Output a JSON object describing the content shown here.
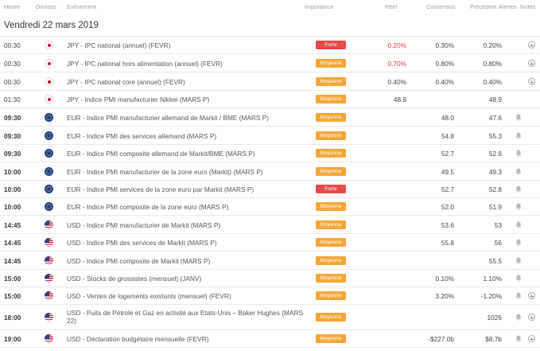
{
  "columns": {
    "time": "Heure",
    "currency": "Devises",
    "event": "Evènement",
    "importance": "Importance",
    "actual": "Réel",
    "consensus": "Consensus",
    "previous": "Précédent",
    "alerts": "Alertes",
    "notes": "Notes"
  },
  "date_heading": "Vendredi 22 mars 2019",
  "rows": [
    {
      "time": "00:30",
      "bold": false,
      "flag": "flag-japan",
      "event": "JPY - IPC national (annuel) (FEVR)",
      "importance": "Forte",
      "level": "high",
      "actual": "0.20%",
      "actual_red": true,
      "consensus": "0.30%",
      "previous": "0.20%",
      "bell": false,
      "plus": true
    },
    {
      "time": "00:30",
      "bold": false,
      "flag": "flag-japan",
      "event": "JPY - IPC national hors alimentation (annuel) (FEVR)",
      "importance": "Moyenne",
      "level": "mid",
      "actual": "0.70%",
      "actual_red": true,
      "consensus": "0.80%",
      "previous": "0.80%",
      "bell": false,
      "plus": true
    },
    {
      "time": "00:30",
      "bold": false,
      "flag": "flag-japan",
      "event": "JPY - IPC national core (annuel) (FEVR)",
      "importance": "Moyenne",
      "level": "mid",
      "actual": "0.40%",
      "actual_red": false,
      "consensus": "0.40%",
      "previous": "0.40%",
      "bell": false,
      "plus": true
    },
    {
      "time": "01:30",
      "bold": false,
      "flag": "flag-japan",
      "event": "JPY - Indice PMI manufacturier Nikkei (MARS P)",
      "importance": "Moyenne",
      "level": "mid",
      "actual": "48.9",
      "actual_red": false,
      "consensus": "",
      "previous": "48.9",
      "bell": false,
      "plus": false
    },
    {
      "time": "09:30",
      "bold": true,
      "flag": "flag-euro",
      "event": "EUR - Indice PMI manufacturier allemand de Markit / BME (MARS P)",
      "importance": "Moyenne",
      "level": "mid",
      "actual": "",
      "actual_red": false,
      "consensus": "48.0",
      "previous": "47.6",
      "bell": true,
      "plus": false
    },
    {
      "time": "09:30",
      "bold": true,
      "flag": "flag-euro",
      "event": "EUR - Indice PMI des services allemand (MARS P)",
      "importance": "Moyenne",
      "level": "mid",
      "actual": "",
      "actual_red": false,
      "consensus": "54.8",
      "previous": "55.3",
      "bell": true,
      "plus": false
    },
    {
      "time": "09:30",
      "bold": true,
      "flag": "flag-euro",
      "event": "EUR - Indice PMI composite allemand de Markit/BME (MARS P)",
      "importance": "Moyenne",
      "level": "mid",
      "actual": "",
      "actual_red": false,
      "consensus": "52.7",
      "previous": "52.8",
      "bell": true,
      "plus": false
    },
    {
      "time": "10:00",
      "bold": true,
      "flag": "flag-euro",
      "event": "EUR - Indice PMI manufacturier de la zone euro (Markit) (MARS P)",
      "importance": "Moyenne",
      "level": "mid",
      "actual": "",
      "actual_red": false,
      "consensus": "49.5",
      "previous": "49.3",
      "bell": true,
      "plus": false
    },
    {
      "time": "10:00",
      "bold": true,
      "flag": "flag-euro",
      "event": "EUR - Indice PMI services de la zone euro par Markit (MARS P)",
      "importance": "Forte",
      "level": "high",
      "actual": "",
      "actual_red": false,
      "consensus": "52.7",
      "previous": "52.8",
      "bell": true,
      "plus": false
    },
    {
      "time": "10:00",
      "bold": true,
      "flag": "flag-euro",
      "event": "EUR - Indice PMI composite de la zone euro (MARS P)",
      "importance": "Moyenne",
      "level": "mid",
      "actual": "",
      "actual_red": false,
      "consensus": "52.0",
      "previous": "51.9",
      "bell": true,
      "plus": false
    },
    {
      "time": "14:45",
      "bold": true,
      "flag": "flag-usa",
      "event": "USD - Indice PMI manufacturier de Markit (MARS P)",
      "importance": "Moyenne",
      "level": "mid",
      "actual": "",
      "actual_red": false,
      "consensus": "53.6",
      "previous": "53",
      "bell": true,
      "plus": false
    },
    {
      "time": "14:45",
      "bold": true,
      "flag": "flag-usa",
      "event": "USD - Indice PMI des services de Markit (MARS P)",
      "importance": "Moyenne",
      "level": "mid",
      "actual": "",
      "actual_red": false,
      "consensus": "55.8",
      "previous": "56",
      "bell": true,
      "plus": false
    },
    {
      "time": "14:45",
      "bold": true,
      "flag": "flag-usa",
      "event": "USD - Indice PMI composite de Markit (MARS P)",
      "importance": "Moyenne",
      "level": "mid",
      "actual": "",
      "actual_red": false,
      "consensus": "",
      "previous": "55.5",
      "bell": true,
      "plus": false
    },
    {
      "time": "15:00",
      "bold": true,
      "flag": "flag-usa",
      "event": "USD - Stocks de grossistes (mensuel) (JANV)",
      "importance": "Moyenne",
      "level": "mid",
      "actual": "",
      "actual_red": false,
      "consensus": "0.10%",
      "previous": "1.10%",
      "bell": true,
      "plus": false
    },
    {
      "time": "15:00",
      "bold": true,
      "flag": "flag-usa",
      "event": "USD - Ventes de logements existants (mensuel) (FEVR)",
      "importance": "Moyenne",
      "level": "mid",
      "actual": "",
      "actual_red": false,
      "consensus": "3.20%",
      "previous": "-1.20%",
      "bell": true,
      "plus": true
    },
    {
      "time": "18:00",
      "bold": true,
      "flag": "flag-usa",
      "event": "USD - Puits de Pétrole et Gaz en activité aux Etats-Unis – Baker Hughes (MARS 22)",
      "importance": "Moyenne",
      "level": "mid",
      "actual": "",
      "actual_red": false,
      "consensus": "",
      "previous": "1026",
      "bell": true,
      "plus": true
    },
    {
      "time": "19:00",
      "bold": true,
      "flag": "flag-usa",
      "event": "USD - Déclaration budgétaire mensuelle (FEVR)",
      "importance": "Moyenne",
      "level": "mid",
      "actual": "",
      "actual_red": false,
      "consensus": "-$227.0b",
      "previous": "$8.7b",
      "bell": true,
      "plus": true
    }
  ]
}
